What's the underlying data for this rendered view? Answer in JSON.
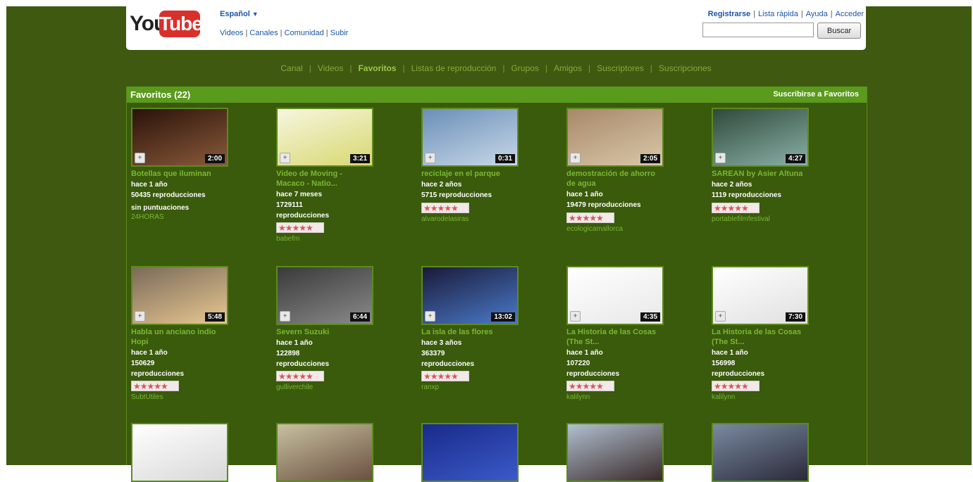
{
  "header": {
    "logo_you": "You",
    "logo_tube": "Tube",
    "language": "Español",
    "nav": [
      "Videos",
      "Canales",
      "Comunidad",
      "Subir"
    ],
    "account": [
      "Registrarse",
      "Lista rápida",
      "Ayuda",
      "Acceder"
    ],
    "search_button": "Buscar"
  },
  "channel_nav": [
    "Canal",
    "Videos",
    "Favoritos",
    "Listas de reproducción",
    "Grupos",
    "Amigos",
    "Suscriptores",
    "Suscripciones"
  ],
  "favorites": {
    "title": "Favoritos (22)",
    "subscribe": "Suscribirse a Favoritos"
  },
  "videos": [
    {
      "title": "Botellas que iluminan",
      "duration": "2:00",
      "age": "hace 1 año",
      "views": "50435 reproducciones",
      "rating": "sin puntuaciones",
      "user": "24HORAS",
      "colors": [
        "#2a120a",
        "#8a5a3a"
      ]
    },
    {
      "title": "Video de Moving - Macaco - Natio...",
      "duration": "3:21",
      "age": "hace 7 meses",
      "views": "1729111 reproducciones",
      "stars": "★★★★★",
      "user": "babefm",
      "colors": [
        "#f6f6e0",
        "#d8d870"
      ]
    },
    {
      "title": "reciclaje en el parque",
      "duration": "0:31",
      "age": "hace 2 años",
      "views": "5715 reproducciones",
      "stars": "★★★★★",
      "user": "alvarodelasiras",
      "colors": [
        "#6a8fb8",
        "#c8d8e8"
      ]
    },
    {
      "title": "demostración de ahorro de agua",
      "duration": "2:05",
      "age": "hace 1 año",
      "views": "19479 reproducciones",
      "stars": "★★★★★",
      "user": "ecologicamallorca",
      "colors": [
        "#a8886a",
        "#d8c8a8"
      ]
    },
    {
      "title": "SAREAN by Asier Altuna",
      "duration": "4:27",
      "age": "hace 2 años",
      "views": "1119 reproducciones",
      "stars": "★★★★★",
      "user": "portablefilmfestival",
      "colors": [
        "#2f4a3a",
        "#8ab0a8"
      ]
    },
    {
      "title": "Habla un anciano indio Hopi",
      "duration": "5:48",
      "age": "hace 1 año",
      "views": "150629 reproducciones",
      "stars": "★★★★★",
      "user": "SubtUtiles",
      "colors": [
        "#7a6a5a",
        "#e8c890"
      ]
    },
    {
      "title": "Severn Suzuki",
      "duration": "6:44",
      "age": "hace 1 año",
      "views": "122898 reproducciones",
      "stars": "★★★★★",
      "user": "gulliverchile",
      "colors": [
        "#3a3a3a",
        "#8a8a8a"
      ]
    },
    {
      "title": "La isla de las flores",
      "duration": "13:02",
      "age": "hace 3 años",
      "views": "363379 reproducciones",
      "stars": "★★★★★",
      "user": "ranxp",
      "colors": [
        "#1a1a3a",
        "#4a7ac8"
      ]
    },
    {
      "title": "La Historia de las Cosas (The St...",
      "duration": "4:35",
      "age": "hace 1 año",
      "views": "107220 reproducciones",
      "stars": "★★★★★",
      "user": "kalilynn",
      "colors": [
        "#ffffff",
        "#e8e8e8"
      ]
    },
    {
      "title": "La Historia de las Cosas (The St...",
      "duration": "7:30",
      "age": "hace 1 año",
      "views": "156998 reproducciones",
      "stars": "★★★★★",
      "user": "kalilynn",
      "colors": [
        "#ffffff",
        "#e0e0e0"
      ]
    },
    {
      "title": "",
      "duration": "",
      "colors": [
        "#ffffff",
        "#d8d8d8"
      ]
    },
    {
      "title": "",
      "duration": "",
      "colors": [
        "#c8c0a0",
        "#6a5040"
      ]
    },
    {
      "title": "",
      "duration": "",
      "colors": [
        "#1a2a8a",
        "#3a5ac8"
      ]
    },
    {
      "title": "",
      "duration": "",
      "colors": [
        "#b0c0d0",
        "#3a2a2a"
      ]
    },
    {
      "title": "",
      "duration": "",
      "colors": [
        "#7a8aa0",
        "#2a2a3a"
      ]
    }
  ]
}
